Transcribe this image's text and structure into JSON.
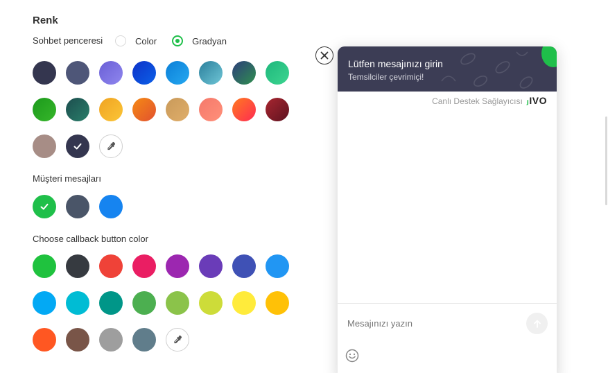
{
  "section_title": "Renk",
  "chat_window": {
    "label": "Sohbet penceresi",
    "options": [
      {
        "label": "Color",
        "checked": false
      },
      {
        "label": "Gradyan",
        "checked": true
      }
    ],
    "swatches": [
      {
        "background": "#34364f"
      },
      {
        "background": "#4e5678"
      },
      {
        "background": "linear-gradient(135deg,#6a5fd6,#8f86ee)"
      },
      {
        "background": "linear-gradient(135deg,#0e32c8,#0b60e8)"
      },
      {
        "background": "linear-gradient(135deg,#0b7fd8,#26a8f0)"
      },
      {
        "background": "linear-gradient(135deg,#2b7f9c,#6fc6d6)"
      },
      {
        "background": "linear-gradient(135deg,#2e3e7a,#2f8f4f)"
      },
      {
        "background": "linear-gradient(135deg,#1eb77c,#3dd590)"
      },
      {
        "background": "linear-gradient(135deg,#1c9a1c,#36b62a)"
      },
      {
        "background": "linear-gradient(135deg,#1c4d4e,#2a7f6a)"
      },
      {
        "background": "linear-gradient(135deg,#f0a322,#fbc537)"
      },
      {
        "background": "linear-gradient(135deg,#f58a14,#e2512f)"
      },
      {
        "background": "linear-gradient(135deg,#c99a5a,#e0ae6a)"
      },
      {
        "background": "linear-gradient(135deg,#f5796b,#ff907a)"
      },
      {
        "background": "linear-gradient(135deg,#ff7a20,#ff2b52)"
      },
      {
        "background": "linear-gradient(135deg,#a82630,#5e1320)"
      },
      {
        "background": "#a78d86"
      },
      {
        "background": "#34364f",
        "selected": true
      },
      {
        "picker": true
      }
    ]
  },
  "customer_messages": {
    "label": "Müşteri mesajları",
    "swatches": [
      {
        "background": "#1fbf4a",
        "selected": true
      },
      {
        "background": "#4a5568"
      },
      {
        "background": "#1684f0"
      }
    ]
  },
  "callback_button": {
    "label": "Choose callback button color",
    "swatches": [
      {
        "background": "#1fc23e"
      },
      {
        "background": "#363a40"
      },
      {
        "background": "#ef4238"
      },
      {
        "background": "#ea1e63"
      },
      {
        "background": "#9c27b0"
      },
      {
        "background": "#6a3cb8"
      },
      {
        "background": "#3f51b5"
      },
      {
        "background": "#2196f3"
      },
      {
        "background": "#03a9f4"
      },
      {
        "background": "#00bcd4"
      },
      {
        "background": "#009688"
      },
      {
        "background": "#4caf50"
      },
      {
        "background": "#8bc34a"
      },
      {
        "background": "#cddc39"
      },
      {
        "background": "#ffeb3b"
      },
      {
        "background": "#ffc107"
      },
      {
        "background": "#ff5722"
      },
      {
        "background": "#795548"
      },
      {
        "background": "#9e9e9e"
      },
      {
        "background": "#607d8b"
      },
      {
        "picker": true
      }
    ]
  },
  "widget": {
    "title": "Lütfen mesajınızı girin",
    "subtitle": "Temsilciler çevrimiçi!",
    "provider_text": "Canlı Destek Sağlayıcısı",
    "provider_logo": "IVO",
    "input_placeholder": "Mesajınızı yazın",
    "header_color": "#3c3d55",
    "accent": "#1fbf4a"
  },
  "icons": {
    "close": "close-icon",
    "send": "arrow-up-icon",
    "emoji": "smiley-icon",
    "picker": "eyedropper-icon",
    "check": "check-icon"
  }
}
